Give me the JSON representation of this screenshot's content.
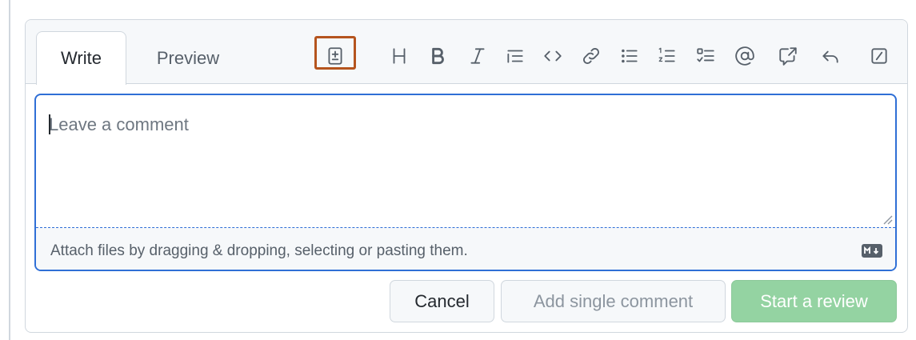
{
  "tabs": {
    "write_label": "Write",
    "preview_label": "Preview"
  },
  "toolbar": {
    "buttons": [
      {
        "name": "insert-suggestion-icon",
        "icon": "file-diff",
        "highlighted": true
      },
      {
        "name": "heading-icon",
        "icon": "heading",
        "glyph": "H"
      },
      {
        "name": "bold-icon",
        "icon": "bold",
        "glyph": "B"
      },
      {
        "name": "italic-icon",
        "icon": "italic",
        "glyph": "I"
      },
      {
        "name": "quote-icon",
        "icon": "quote"
      },
      {
        "name": "code-icon",
        "icon": "code"
      },
      {
        "name": "link-icon",
        "icon": "link"
      },
      {
        "name": "bulleted-list-icon",
        "icon": "list-unordered"
      },
      {
        "name": "numbered-list-icon",
        "icon": "list-ordered"
      },
      {
        "name": "task-list-icon",
        "icon": "tasklist"
      },
      {
        "name": "mention-icon",
        "icon": "mention"
      },
      {
        "name": "cross-reference-icon",
        "icon": "cross-reference"
      },
      {
        "name": "reply-icon",
        "icon": "reply"
      },
      {
        "name": "slash-command-icon",
        "icon": "slash"
      }
    ],
    "highlight_color": "#b5541e"
  },
  "editor": {
    "placeholder": "Leave a comment",
    "attach_hint": "Attach files by dragging & dropping, selecting or pasting them.",
    "markdown_icon": "markdown-icon",
    "focus_color": "#2f6fd6"
  },
  "actions": {
    "cancel_label": "Cancel",
    "add_single_label": "Add single comment",
    "start_review_label": "Start a review",
    "start_review_color": "#94d3a2"
  }
}
